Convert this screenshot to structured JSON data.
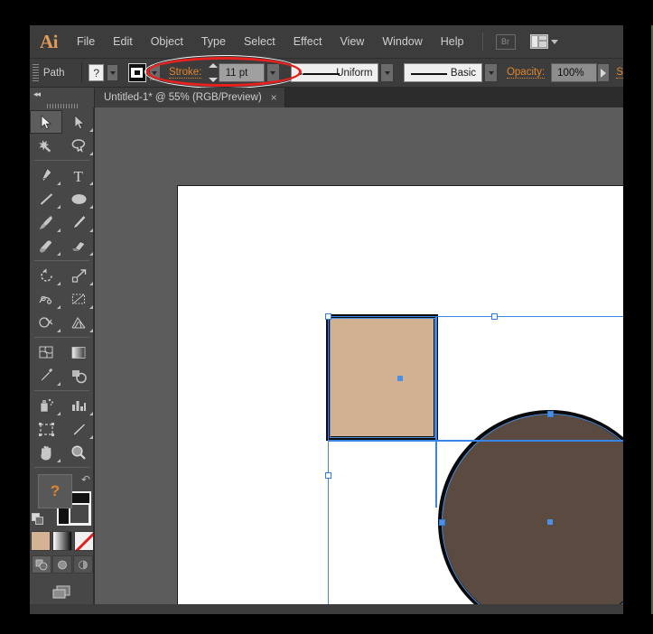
{
  "app": {
    "name": "Adobe Illustrator",
    "logo_text": "Ai",
    "accent_orange": "#e0852f",
    "chrome_bg": "#3c3c3c",
    "panel_bg": "#474747",
    "canvas_bg": "#5c5c5c",
    "selection_blue": "#4d8fe0",
    "annotation_red": "#e8201e"
  },
  "menubar": {
    "items": [
      {
        "label": "File"
      },
      {
        "label": "Edit"
      },
      {
        "label": "Object"
      },
      {
        "label": "Type"
      },
      {
        "label": "Select"
      },
      {
        "label": "Effect"
      },
      {
        "label": "View"
      },
      {
        "label": "Window"
      },
      {
        "label": "Help"
      }
    ],
    "bridge_label": "Br",
    "arrange_documents_label": ""
  },
  "controlbar": {
    "object_type_label": "Path",
    "help_button_label": "?",
    "stroke_label": "Stroke:",
    "stroke_weight_value": "11 pt",
    "variable_width_profile": "Uniform",
    "brush_definition": "Basic",
    "opacity_label": "Opacity:",
    "opacity_value": "100%",
    "style_label_truncated": "S"
  },
  "tabbar": {
    "document_tab_title": "Untitled-1* @ 55% (RGB/Preview)",
    "close_glyph": "×"
  },
  "toolbox": {
    "collapse_glyph": "◂◂",
    "tools": [
      {
        "name": "selection-tool",
        "active": true
      },
      {
        "name": "direct-selection-tool",
        "active": false
      },
      {
        "name": "magic-wand-tool",
        "active": false
      },
      {
        "name": "lasso-tool",
        "active": false
      },
      {
        "name": "pen-tool",
        "active": false
      },
      {
        "name": "type-tool",
        "active": false
      },
      {
        "name": "line-segment-tool",
        "active": false
      },
      {
        "name": "ellipse-tool",
        "active": false
      },
      {
        "name": "paintbrush-tool",
        "active": false
      },
      {
        "name": "pencil-tool",
        "active": false
      },
      {
        "name": "blob-brush-tool",
        "active": false
      },
      {
        "name": "eraser-tool",
        "active": false
      },
      {
        "name": "rotate-tool",
        "active": false
      },
      {
        "name": "scale-tool",
        "active": false
      },
      {
        "name": "width-tool",
        "active": false
      },
      {
        "name": "free-transform-tool",
        "active": false
      },
      {
        "name": "shape-builder-tool",
        "active": false
      },
      {
        "name": "perspective-grid-tool",
        "active": false
      },
      {
        "name": "mesh-tool",
        "active": false
      },
      {
        "name": "gradient-tool",
        "active": false
      },
      {
        "name": "eyedropper-tool",
        "active": false
      },
      {
        "name": "blend-tool",
        "active": false
      },
      {
        "name": "symbol-sprayer-tool",
        "active": false
      },
      {
        "name": "column-graph-tool",
        "active": false
      },
      {
        "name": "artboard-tool",
        "active": false
      },
      {
        "name": "slice-tool",
        "active": false
      },
      {
        "name": "hand-tool",
        "active": false
      },
      {
        "name": "zoom-tool",
        "active": false
      }
    ],
    "fill_swatch_label": "?",
    "stroke_color": "#0a0a0a",
    "color_swatches": [
      {
        "name": "fill-color-swatch",
        "value": "#d4b294"
      },
      {
        "name": "gradient-swatch",
        "value": "gradient"
      },
      {
        "name": "none-swatch",
        "value": "none"
      }
    ],
    "draw_modes": [
      {
        "name": "draw-normal-mode",
        "active": true
      },
      {
        "name": "draw-behind-mode",
        "active": false
      },
      {
        "name": "draw-inside-mode",
        "active": false
      }
    ],
    "screen_mode_name": "change-screen-mode"
  },
  "canvas": {
    "zoom_level": "55%",
    "color_mode": "RGB",
    "view_mode": "Preview",
    "objects": [
      {
        "name": "rectangle-shape",
        "fill": "#d2b092",
        "stroke": "#0a0a0a",
        "stroke_weight": "11 pt",
        "selected": true
      },
      {
        "name": "circle-shape",
        "fill": "#5a4a40",
        "stroke": "#0a0a0a",
        "stroke_weight": "11 pt",
        "selected": true
      }
    ]
  },
  "annotation": {
    "name": "stroke-weight-highlight",
    "shape": "ellipse",
    "color": "#e8201e"
  }
}
